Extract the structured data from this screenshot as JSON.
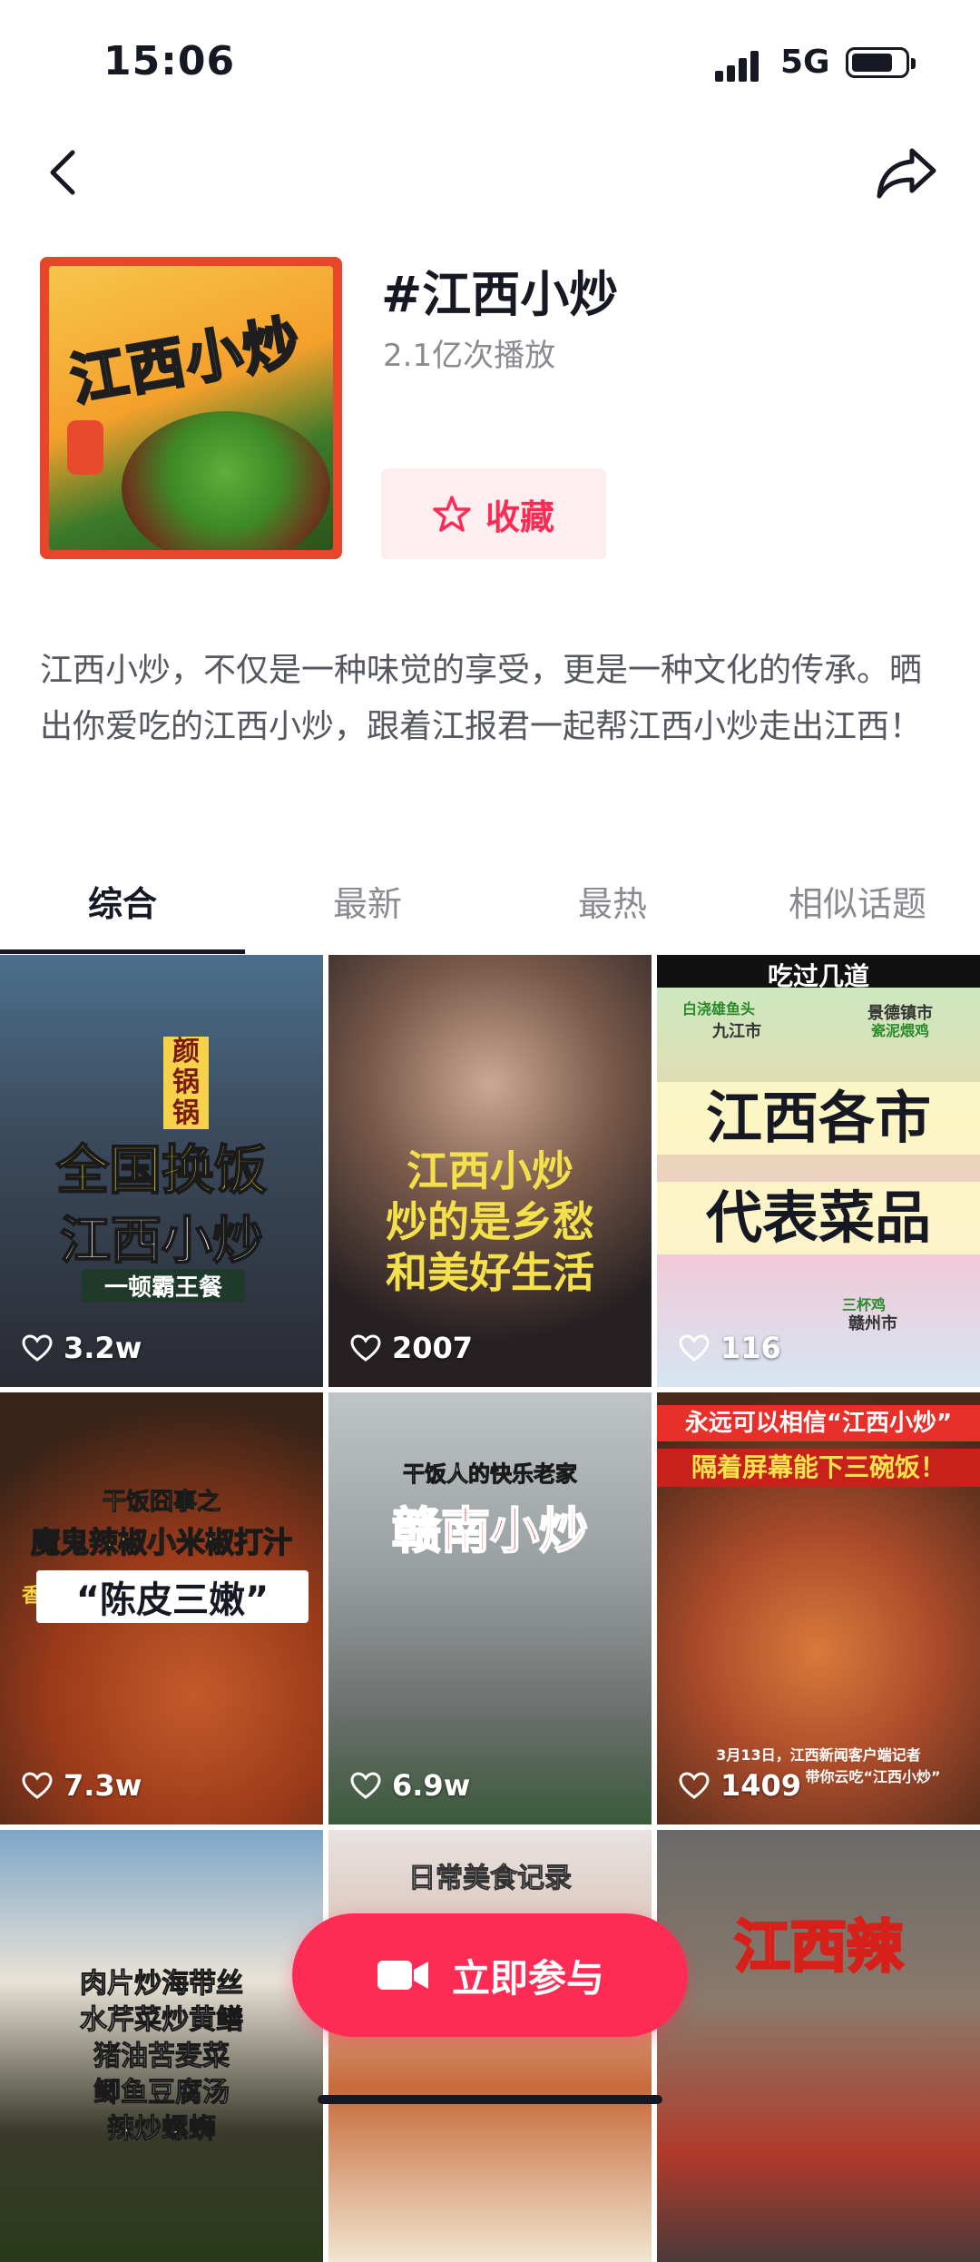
{
  "status": {
    "time": "15:06",
    "network": "5G"
  },
  "topic": {
    "title": "#江西小炒",
    "plays": "2.1亿次播放",
    "cover_text": "江西小炒",
    "favorite_label": "收藏",
    "description": "江西小炒，不仅是一种味觉的享受，更是一种文化的传承。晒出你爱吃的江西小炒，跟着江报君一起帮江西小炒走出江西！"
  },
  "tabs": [
    {
      "label": "综合"
    },
    {
      "label": "最新"
    },
    {
      "label": "最热"
    },
    {
      "label": "相似话题"
    }
  ],
  "videos": [
    {
      "lines": [
        "颜锅锅",
        "全国换饭",
        "江西小炒",
        "一顿霸王餐"
      ],
      "likes": "3.2w"
    },
    {
      "lines": [
        "江西小炒",
        "炒的是乡愁",
        "和美好生活"
      ],
      "likes": "2007"
    },
    {
      "lines": [
        "吃过几道",
        "九江市",
        "景德镇市",
        "白浇雄鱼头",
        "瓷泥煨鸡",
        "江西各市",
        "代表菜品",
        "三杯鸡",
        "赣州市"
      ],
      "likes": "116"
    },
    {
      "lines": [
        "干饭囧事之",
        "魔鬼辣椒小米椒打汁",
        "香辣爆炒",
        "“陈皮三嫩”"
      ],
      "likes": "7.3w"
    },
    {
      "lines": [
        "干饭人的快乐老家",
        "赣南小炒"
      ],
      "likes": "6.9w"
    },
    {
      "lines": [
        "永远可以相信“江西小炒”",
        "隔着屏幕能下三碗饭！",
        "3月13日，江西新闻客户端记者",
        "带你云吃“江西小炒”"
      ],
      "likes": "1409"
    },
    {
      "lines": [
        "肉片炒海带丝",
        "水芹菜炒黄鳝",
        "猪油苦麦菜",
        "鲫鱼豆腐汤",
        "辣炒螺蛳"
      ],
      "likes": ""
    },
    {
      "lines": [
        "日常美食记录"
      ],
      "likes": ""
    },
    {
      "lines": [
        "江西辣"
      ],
      "likes": ""
    }
  ],
  "join_label": "立即参与",
  "colors": {
    "accent": "#fe2c55",
    "accent_bg": "#fdeef0",
    "text": "#161823",
    "muted": "#8a8b91"
  }
}
